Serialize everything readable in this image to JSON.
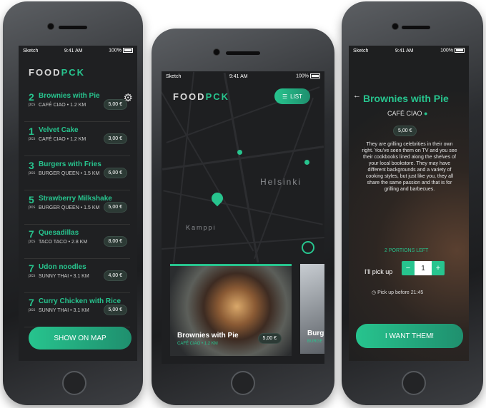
{
  "status": {
    "carrier": "Sketch",
    "time": "9:41 AM",
    "battery": "100%"
  },
  "logo": {
    "food": "FOOD",
    "pck": "PCK"
  },
  "list_screen": {
    "items": [
      {
        "qty": "2",
        "pcs": "pcs",
        "name": "Brownies with Pie",
        "place": "CAFÉ CIAO",
        "distance": "1.2 KM",
        "price": "5,00 €"
      },
      {
        "qty": "1",
        "pcs": "pcs",
        "name": "Velvet Cake",
        "place": "CAFÉ CIAO",
        "distance": "1.2 KM",
        "price": "3,00 €"
      },
      {
        "qty": "3",
        "pcs": "pcs",
        "name": "Burgers with Fries",
        "place": "BURGER QUEEN",
        "distance": "1.5 KM",
        "price": "6,00 €"
      },
      {
        "qty": "5",
        "pcs": "pcs",
        "name": "Strawberry Milkshake",
        "place": "BURGER QUEEN",
        "distance": "1.5 KM",
        "price": "5,00 €"
      },
      {
        "qty": "7",
        "pcs": "pcs",
        "name": "Quesadillas",
        "place": "TACO TACO",
        "distance": "2.8 KM",
        "price": "8,00 €"
      },
      {
        "qty": "7",
        "pcs": "pcs",
        "name": "Udon noodles",
        "place": "SUNNY THAI",
        "distance": "3.1 KM",
        "price": "4,00 €"
      },
      {
        "qty": "7",
        "pcs": "pcs",
        "name": "Curry Chicken with Rice",
        "place": "SUNNY THAI",
        "distance": "3.1 KM",
        "price": "5,00 €"
      }
    ],
    "show_on_map": "SHOW ON MAP"
  },
  "map_screen": {
    "list_button": "LIST",
    "city_label": "Helsinki",
    "district_label": "Kamppi",
    "card": {
      "name": "Brownies with Pie",
      "place": "CAFÉ CIAO",
      "distance": "1.2 KM",
      "price": "5,00 €"
    },
    "next_card_name": "Burg",
    "next_card_place": "BURGE"
  },
  "detail_screen": {
    "title": "Brownies with Pie",
    "place": "CAFÉ CIAO",
    "price": "5,00 €",
    "description": "They are grilling celebrities in their own right. You've seen them on TV and you see their cookbooks lined along the shelves of your local bookstore. They may have different backgrounds and a variety of cooking styles, but just like you, they all share the same passion and that is for grilling and barbecues.",
    "portions_left": "2 PORTIONS LEFT",
    "pickup_label": "I'll pick up",
    "minus": "−",
    "quantity": "1",
    "plus": "+",
    "pickup_before": "Pick up before 21:45",
    "cta": "I WANT THEM!"
  },
  "colors": {
    "accent": "#27c48e",
    "background": "#1f2022"
  }
}
